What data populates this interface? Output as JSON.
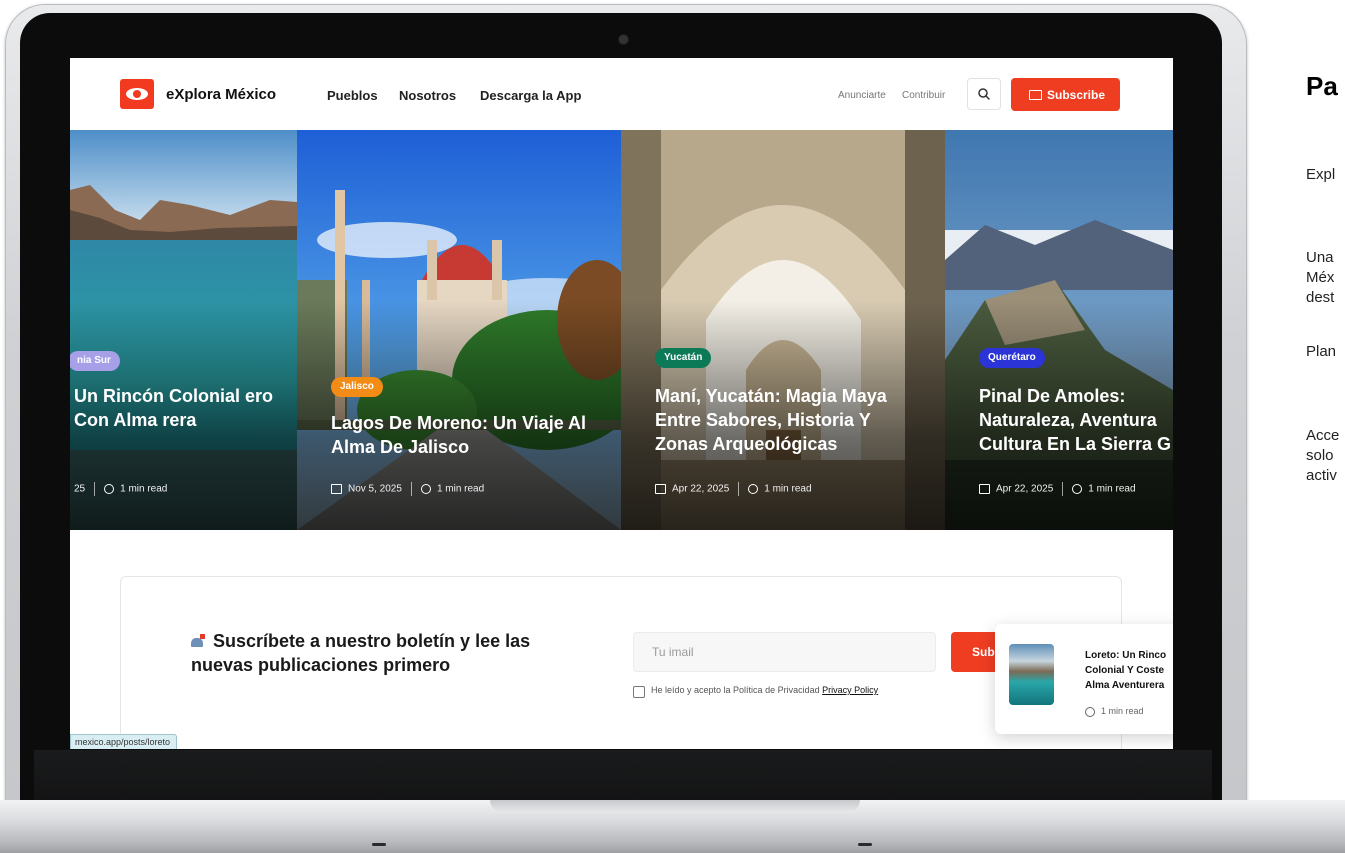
{
  "nav": {
    "brand": "eXplora México",
    "links": [
      "Pueblos",
      "Nosotros",
      "Descarga la App"
    ],
    "secondary": [
      "Anunciarte",
      "Contribuir"
    ],
    "subscribe_label": "Subscribe"
  },
  "cards": [
    {
      "badge": "nia Sur",
      "title": "Un Rincón Colonial ero Con Alma rera",
      "date": "25",
      "read": "1 min read",
      "badge_color": "#a7a0e8"
    },
    {
      "badge": "Jalisco",
      "title": "Lagos De Moreno: Un Viaje Al Alma De Jalisco",
      "date": "Nov 5, 2025",
      "read": "1 min read",
      "badge_color": "#f28c17"
    },
    {
      "badge": "Yucatán",
      "title": "Maní, Yucatán: Magia Maya Entre Sabores, Historia Y Zonas Arqueológicas",
      "date": "Apr 22, 2025",
      "read": "1 min read",
      "badge_color": "#0c7a57"
    },
    {
      "badge": "Querétaro",
      "title": "Pinal De Amoles: Naturaleza, Aventura Cultura En La Sierra G",
      "date": "Apr 22, 2025",
      "read": "1 min read",
      "badge_color": "#2b34d6"
    }
  ],
  "newsletter": {
    "title": "Suscríbete a nuestro boletín y lee las nuevas publicaciones primero",
    "email_placeholder": "Tu imail",
    "submit_label": "Sub",
    "consent": "He leído y acepto la Política de Privacidad",
    "privacy_link": "Privacy Policy"
  },
  "popup": {
    "title": "Loreto: Un Rinco Colonial Y Coste Alma Aventurera",
    "read": "1 min read"
  },
  "status_url": "mexico.app/posts/loreto",
  "side": {
    "heading": "Pa",
    "lines": [
      "Expl",
      "Una",
      "Méx",
      "dest",
      "Plan",
      "Acce",
      "solo",
      "activ"
    ]
  },
  "colors": {
    "accent": "#ef3d22"
  }
}
